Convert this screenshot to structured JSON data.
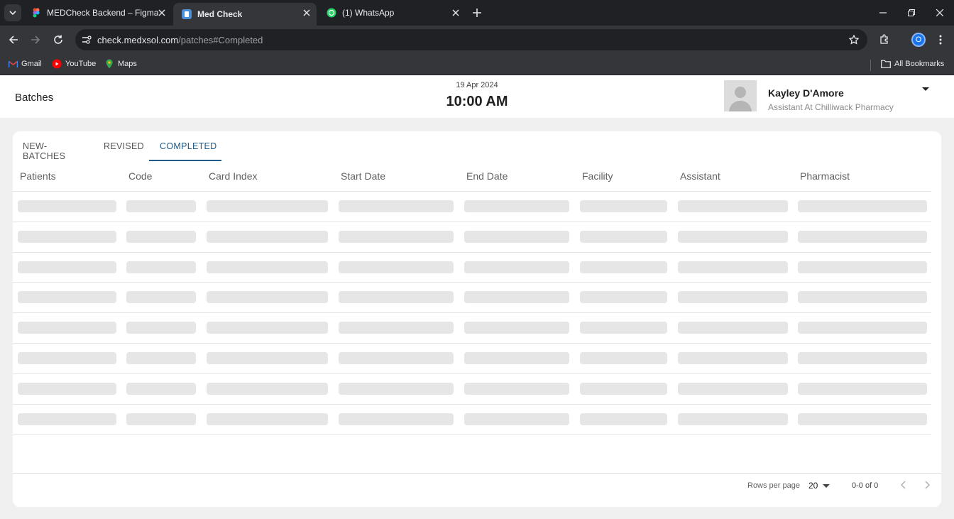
{
  "browser": {
    "tabs": [
      {
        "title": "MEDCheck Backend – Figma",
        "icon": "figma-icon"
      },
      {
        "title": "Med Check",
        "icon": "medcheck-icon",
        "active": true
      },
      {
        "title": "(1) WhatsApp",
        "icon": "whatsapp-icon"
      }
    ],
    "url_host": "check.medxsol.com",
    "url_path": "/patches#Completed",
    "profile_initial": "O",
    "bookmarks": [
      {
        "label": "Gmail",
        "icon": "gmail-icon"
      },
      {
        "label": "YouTube",
        "icon": "youtube-icon"
      },
      {
        "label": "Maps",
        "icon": "maps-icon"
      }
    ],
    "all_bookmarks": "All Bookmarks"
  },
  "header": {
    "page_title": "Batches",
    "date": "19 Apr 2024",
    "time": "10:00 AM",
    "user_name": "Kayley D'Amore",
    "user_role": "Assistant At Chilliwack Pharmacy"
  },
  "tabs": [
    {
      "label": "NEW-BATCHES"
    },
    {
      "label": "REVISED"
    },
    {
      "label": "COMPLETED",
      "active": true
    }
  ],
  "table": {
    "columns": [
      "Patients",
      "Code",
      "Card Index",
      "Start Date",
      "End Date",
      "Facility",
      "Assistant",
      "Pharmacist"
    ],
    "loading_rows": 8
  },
  "pagination": {
    "rows_per_page_label": "Rows per page",
    "rows_per_page": "20",
    "range": "0-0 of 0"
  },
  "colors": {
    "accent": "#1e5a8a",
    "skeleton": "#e6e6e6",
    "chrome_dark": "#202124",
    "chrome_mid": "#35363a"
  }
}
